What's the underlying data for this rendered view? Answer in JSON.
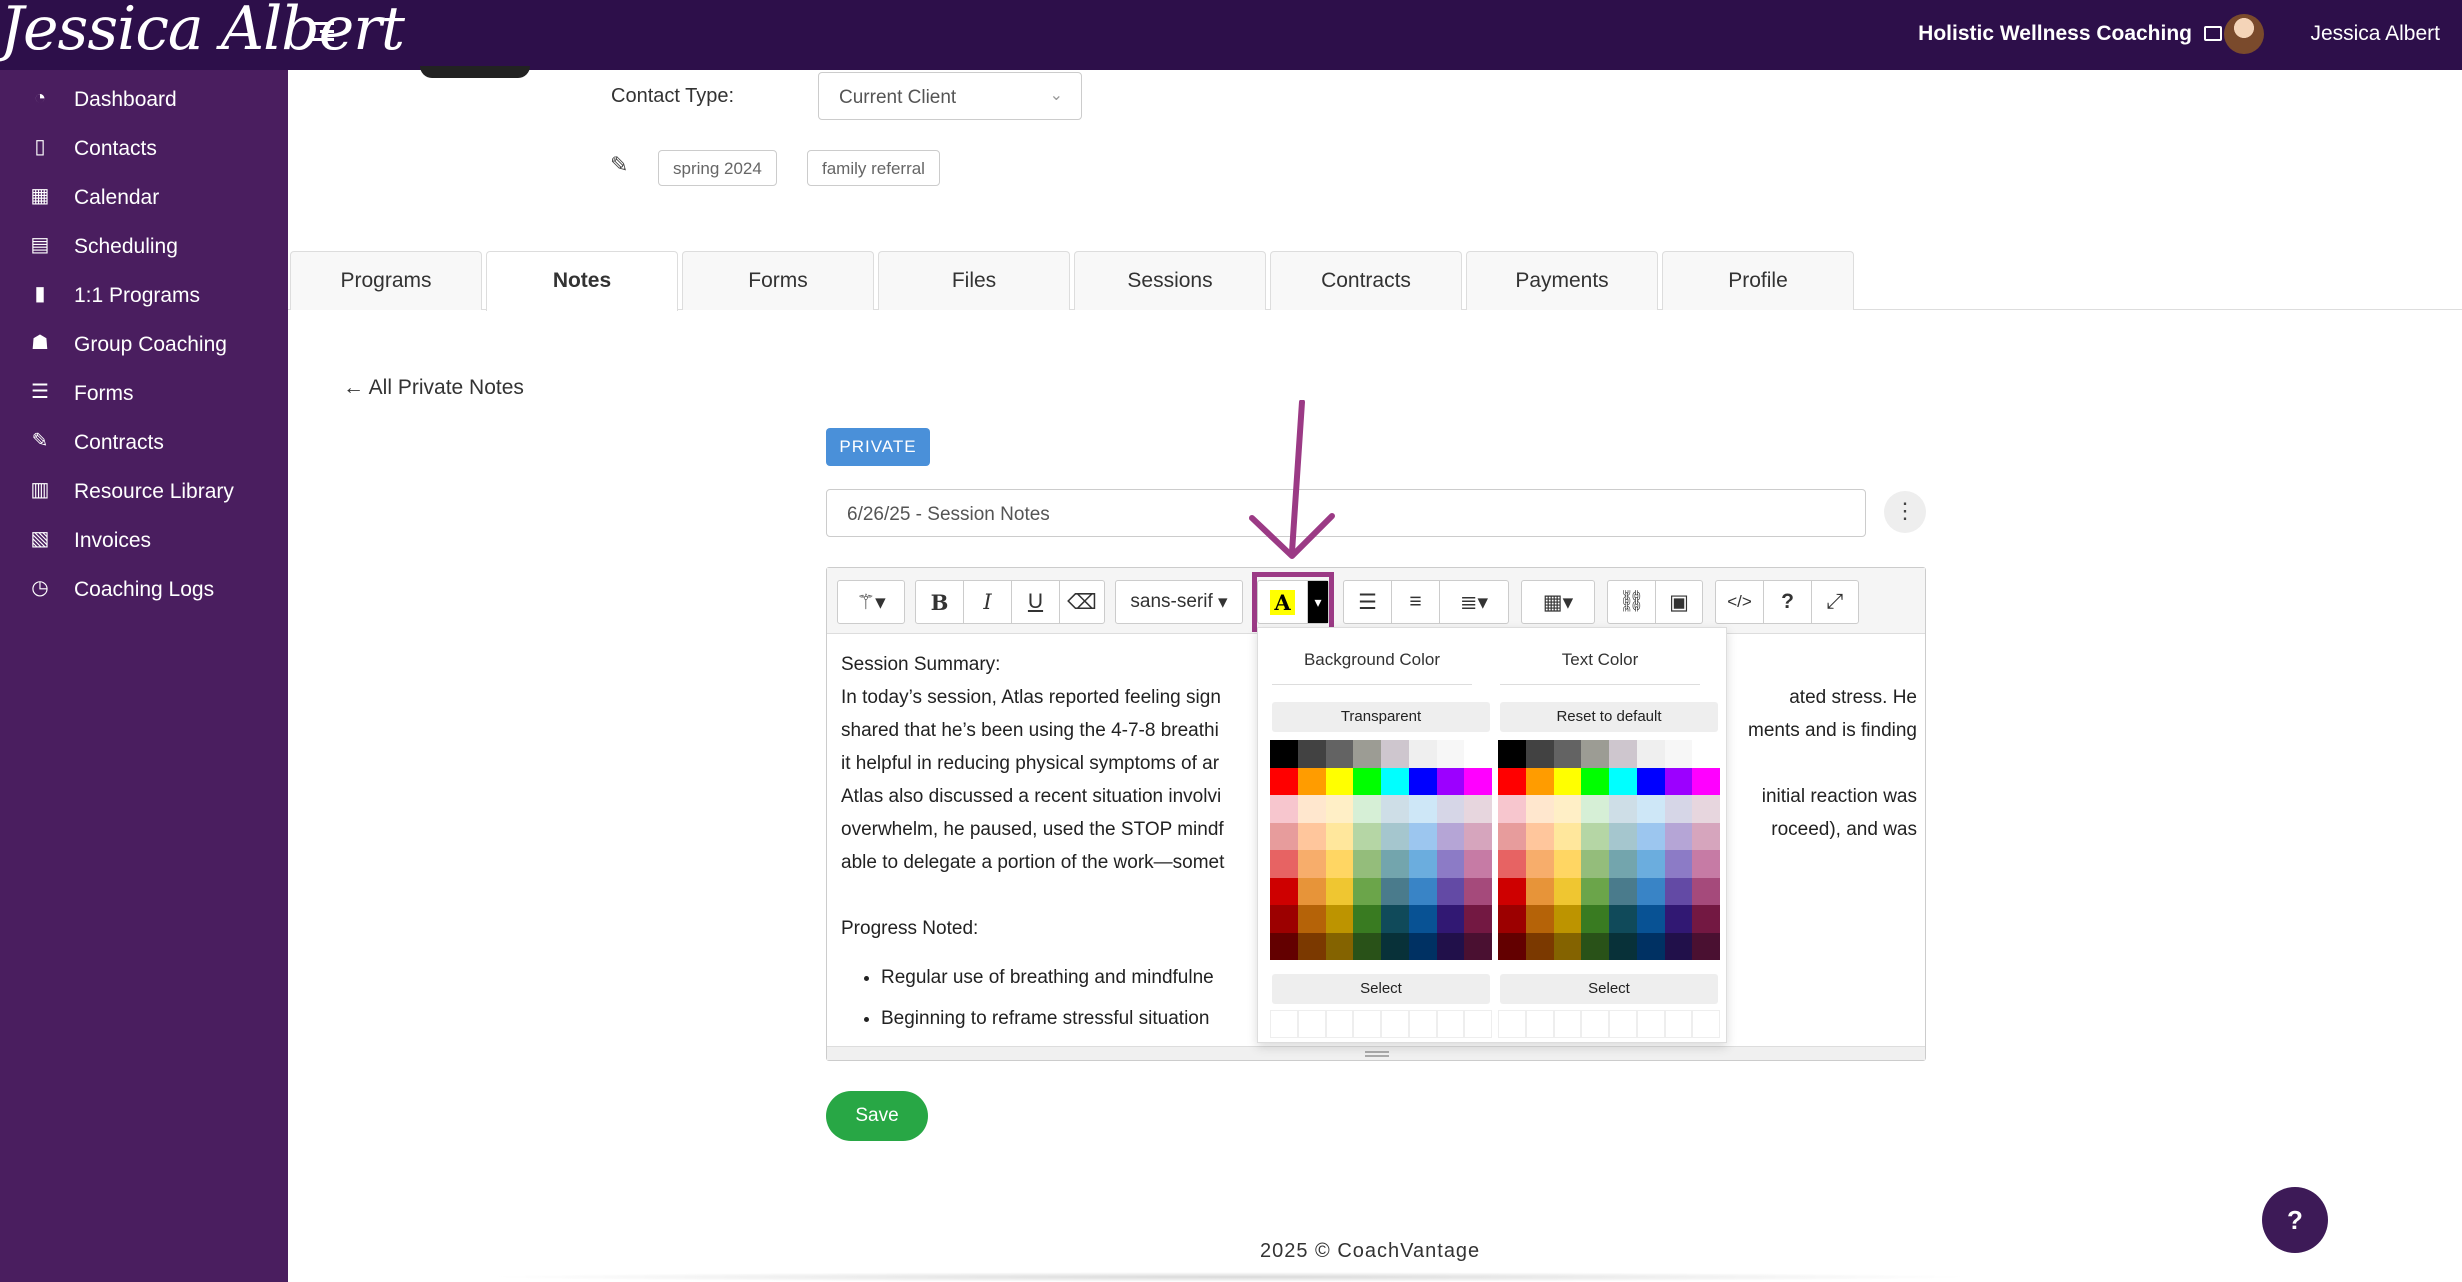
{
  "app": {
    "logo_text": "Jessica Albert",
    "brand": "Holistic Wellness Coaching",
    "username": "Jessica Albert"
  },
  "sidebar": {
    "items": [
      {
        "label": "Dashboard",
        "icon": "dashboard-icon",
        "glyph": "◔"
      },
      {
        "label": "Contacts",
        "icon": "contacts-icon",
        "glyph": "▯"
      },
      {
        "label": "Calendar",
        "icon": "calendar-icon",
        "glyph": "▦"
      },
      {
        "label": "Scheduling",
        "icon": "scheduling-icon",
        "glyph": "▤"
      },
      {
        "label": "1:1 Programs",
        "icon": "book-icon",
        "glyph": "▮"
      },
      {
        "label": "Group Coaching",
        "icon": "group-icon",
        "glyph": "☗"
      },
      {
        "label": "Forms",
        "icon": "forms-icon",
        "glyph": "☰"
      },
      {
        "label": "Contracts",
        "icon": "contracts-icon",
        "glyph": "✎"
      },
      {
        "label": "Resource Library",
        "icon": "library-icon",
        "glyph": "▥"
      },
      {
        "label": "Invoices",
        "icon": "invoices-icon",
        "glyph": "▧"
      },
      {
        "label": "Coaching Logs",
        "icon": "clock-icon",
        "glyph": "◷"
      }
    ]
  },
  "contact": {
    "type_label": "Contact Type:",
    "type_value": "Current Client",
    "tags": [
      "spring 2024",
      "family referral"
    ]
  },
  "tabs": [
    "Programs",
    "Notes",
    "Forms",
    "Files",
    "Sessions",
    "Contracts",
    "Payments",
    "Profile"
  ],
  "active_tab": "Notes",
  "notes": {
    "back_link": "← All Private Notes",
    "badge": "PRIVATE",
    "title": "6/26/25 - Session Notes",
    "save_label": "Save"
  },
  "toolbar": {
    "font_name": "sans-serif",
    "font_color_glyph": "A"
  },
  "editor": {
    "lines": [
      "Session Summary:",
      "In today’s session, Atlas reported feeling sign",
      "shared that he’s been using the 4-7-8 breathi",
      "it helpful in reducing physical symptoms of ar",
      "Atlas also discussed a recent situation involvi",
      "overwhelm, he paused, used the STOP mindf",
      "able to delegate a portion of the work—somet",
      "",
      "Progress Noted:"
    ],
    "right_fragments": [
      "ated stress. He",
      "ments and is finding",
      "",
      "initial reaction was",
      "roceed), and was"
    ],
    "bullets": [
      "Regular use of breathing and mindfulne",
      "Beginning to reframe stressful situation"
    ]
  },
  "color_picker": {
    "background": {
      "title": "Background Color",
      "reset_label": "Transparent",
      "select_label": "Select"
    },
    "text": {
      "title": "Text Color",
      "reset_label": "Reset to default",
      "select_label": "Select"
    },
    "palette": [
      [
        "#000000",
        "#424242",
        "#636363",
        "#9C9C94",
        "#CEC6CE",
        "#EFEFEF",
        "#F7F7F7",
        "#FFFFFF"
      ],
      [
        "#FF0000",
        "#FF9C00",
        "#FFFF00",
        "#00FF00",
        "#00FFFF",
        "#0000FF",
        "#9C00FF",
        "#FF00FF"
      ],
      [
        "#F7C6CE",
        "#FFE7CE",
        "#FFEFC6",
        "#D6EFD6",
        "#CEDEE7",
        "#CEE7F7",
        "#D6D6E7",
        "#E7D6DE"
      ],
      [
        "#E79C9C",
        "#FFC69C",
        "#FFE79C",
        "#B5D6A5",
        "#A5C6CE",
        "#9CC6EF",
        "#B5A5D6",
        "#D6A5BD"
      ],
      [
        "#E76363",
        "#F7AD6B",
        "#FFD663",
        "#94BD7B",
        "#73A5AD",
        "#6BADDE",
        "#8C7BC6",
        "#C67BA5"
      ],
      [
        "#CE0000",
        "#E79439",
        "#EFC631",
        "#6BA54A",
        "#4A7B8C",
        "#3984C6",
        "#634AA5",
        "#A54A7B"
      ],
      [
        "#9C0000",
        "#B56308",
        "#BD9400",
        "#397B21",
        "#104A5A",
        "#085294",
        "#311873",
        "#731842"
      ],
      [
        "#630000",
        "#7B3900",
        "#846300",
        "#295218",
        "#083139",
        "#003163",
        "#21104A",
        "#4A1031"
      ]
    ]
  },
  "footer": {
    "text": "2025 © CoachVantage"
  },
  "help": {
    "label": "?"
  },
  "colors": {
    "topbar": "#2d0f4a",
    "sidebar": "#4a1e5f",
    "badge": "#4a90d9",
    "save": "#28a745",
    "annotation": "#9b3a85"
  }
}
